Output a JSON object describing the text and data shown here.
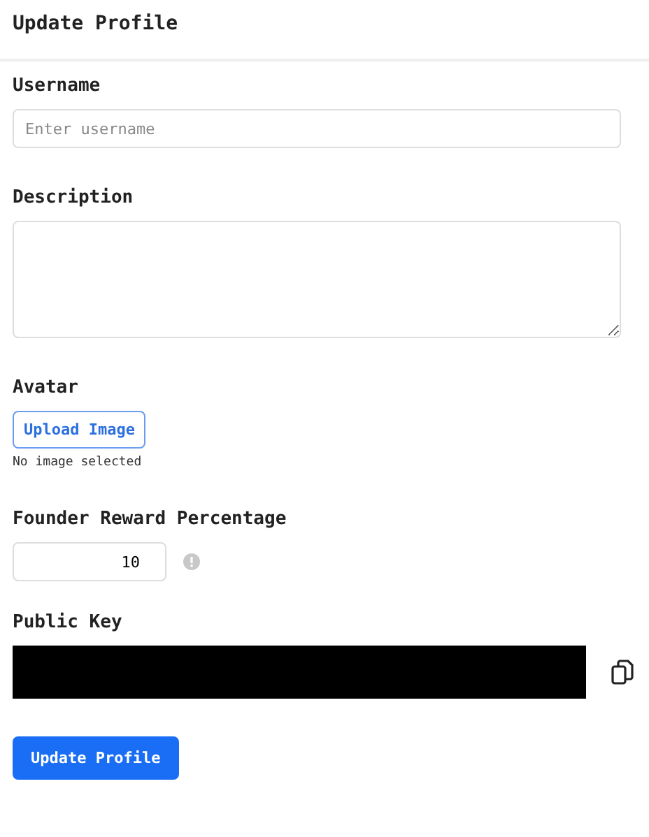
{
  "title": "Update Profile",
  "username": {
    "label": "Username",
    "placeholder": "Enter username"
  },
  "description": {
    "label": "Description"
  },
  "avatar": {
    "label": "Avatar",
    "button": "Upload Image",
    "status": "No image selected"
  },
  "founder_reward": {
    "label": "Founder Reward Percentage",
    "value": "10"
  },
  "public_key": {
    "label": "Public Key"
  },
  "submit": "Update Profile"
}
